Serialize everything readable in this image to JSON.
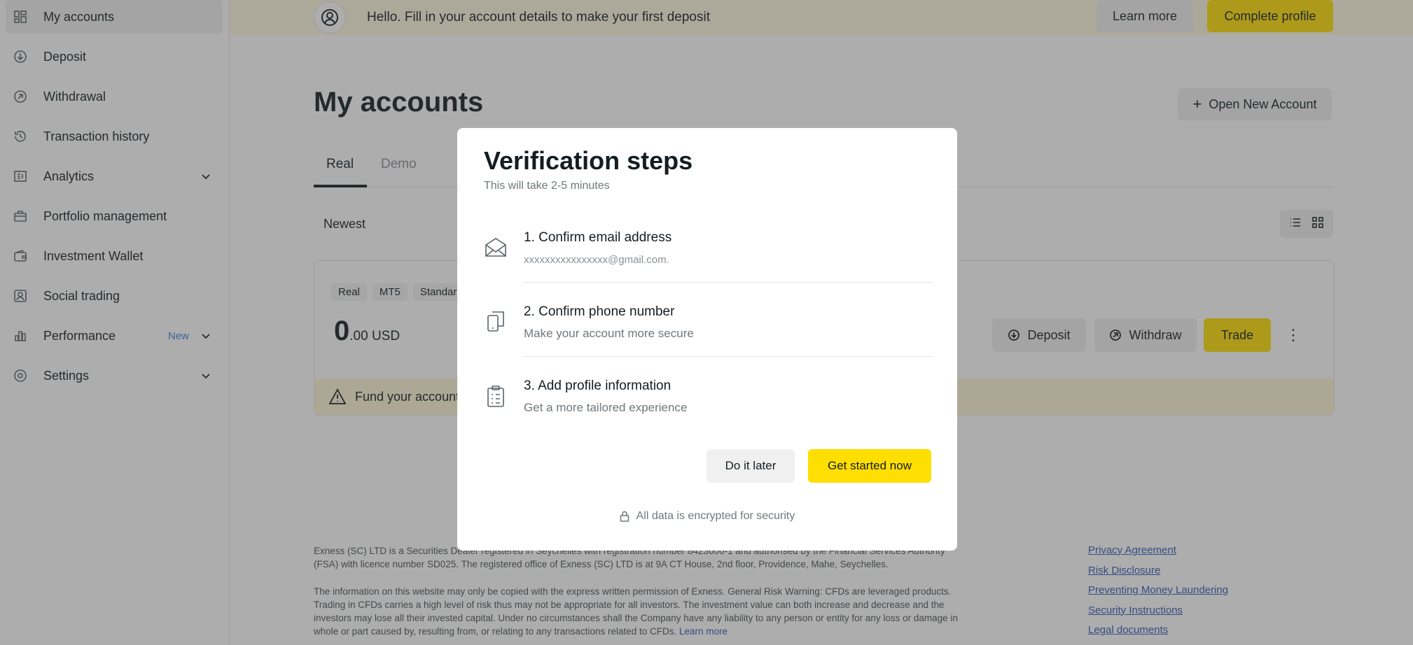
{
  "sidebar": {
    "items": [
      {
        "label": "My accounts",
        "icon": "dashboard-icon"
      },
      {
        "label": "Deposit",
        "icon": "deposit-icon"
      },
      {
        "label": "Withdrawal",
        "icon": "withdrawal-icon"
      },
      {
        "label": "Transaction history",
        "icon": "history-icon"
      },
      {
        "label": "Analytics",
        "icon": "analytics-icon"
      },
      {
        "label": "Portfolio management",
        "icon": "briefcase-icon"
      },
      {
        "label": "Investment Wallet",
        "icon": "wallet-icon"
      },
      {
        "label": "Social trading",
        "icon": "social-trading-icon"
      },
      {
        "label": "Performance",
        "icon": "bar-chart-icon",
        "badge": "New"
      },
      {
        "label": "Settings",
        "icon": "gear-icon"
      }
    ]
  },
  "banner": {
    "text": "Hello. Fill in your account details to make your first deposit",
    "learn_more": "Learn more",
    "complete_profile": "Complete profile"
  },
  "main": {
    "title": "My accounts",
    "open_new_account": "Open New Account",
    "tabs": [
      "Real",
      "Demo"
    ],
    "sort": "Newest"
  },
  "account_card": {
    "tags": [
      "Real",
      "MT5",
      "Standard"
    ],
    "balance_int": "0",
    "balance_dec": ".00 USD",
    "deposit": "Deposit",
    "withdraw": "Withdraw",
    "trade": "Trade",
    "fund_notice": "Fund your account"
  },
  "footer": {
    "para1": "Exness (SC) LTD is a Securities Dealer registered in Seychelles with registration number 8423606-1 and authorised by the Financial Services Authority (FSA) with licence number SD025. The registered office of Exness (SC) LTD is at 9A CT House, 2nd floor, Providence, Mahe, Seychelles.",
    "para2": "The information on this website may only be copied with the express written permission of Exness. General Risk Warning: CFDs are leveraged products. Trading in CFDs carries a high level of risk thus may not be appropriate for all investors. The investment value can both increase and decrease and the investors may lose all their invested capital. Under no circumstances shall the Company have any liability to any person or entity for any loss or damage in whole or part caused by, resulting from, or relating to any transactions related to CFDs.",
    "learn_more": "Learn more",
    "links": [
      "Privacy Agreement",
      "Risk Disclosure",
      "Preventing Money Laundering",
      "Security Instructions",
      "Legal documents"
    ]
  },
  "modal": {
    "title": "Verification steps",
    "subtitle": "This will take 2-5 minutes",
    "steps": [
      {
        "title": "1. Confirm email address",
        "desc": "xxxxxxxxxxxxxxxx@gmail.com."
      },
      {
        "title": "2. Confirm phone number",
        "desc": "Make your account more secure"
      },
      {
        "title": "3. Add profile information",
        "desc": "Get a more tailored experience"
      }
    ],
    "do_it_later": "Do it later",
    "get_started": "Get started now",
    "security_note": "All data is encrypted for security"
  },
  "colors": {
    "accent_yellow": "#ffde02",
    "banner_bg": "#fff9de",
    "link_blue": "#3057b5"
  }
}
